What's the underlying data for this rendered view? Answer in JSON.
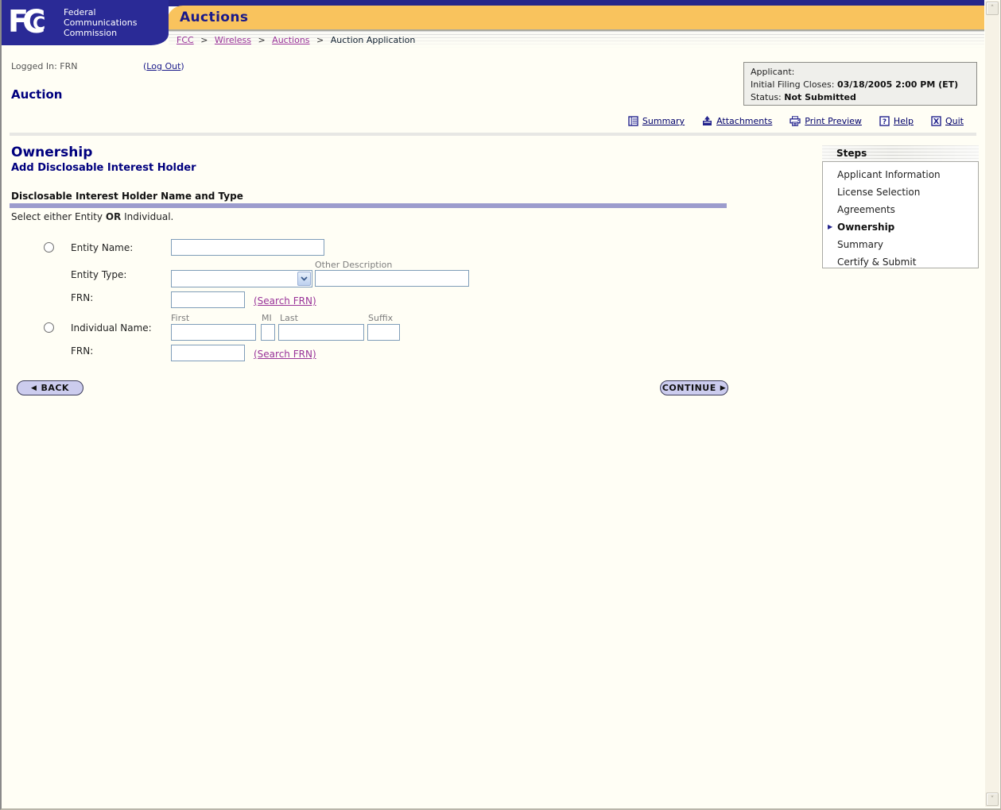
{
  "header": {
    "logo": {
      "f": "F",
      "c1": "C",
      "c2": "C",
      "org": [
        "Federal",
        "Communications",
        "Commission"
      ]
    },
    "app_title": "Auctions",
    "breadcrumb": {
      "separator": ">",
      "links": [
        "FCC",
        "Wireless",
        "Auctions"
      ],
      "current": "Auction Application"
    }
  },
  "session": {
    "logged_in": "Logged In: FRN",
    "logout_open": "(",
    "logout": "Log Out",
    "logout_close": ")"
  },
  "page": {
    "title": "Auction"
  },
  "applicant_box": {
    "applicant_label": "Applicant:",
    "filing_label": "Initial Filing Closes:",
    "filing_value": "03/18/2005 2:00 PM (ET)",
    "status_label": "Status:",
    "status_value": "Not Submitted"
  },
  "toolbar": {
    "summary": "Summary",
    "attachments": "Attachments",
    "print_preview": "Print Preview",
    "help": "Help",
    "quit": "Quit"
  },
  "icons": {
    "help_glyph": "?",
    "quit_glyph": "X",
    "up_arrow": "˄",
    "down_arrow": "˅"
  },
  "content": {
    "title": "Ownership",
    "subtitle": "Add Disclosable Interest Holder",
    "group_heading": "Disclosable Interest Holder Name and Type",
    "instruction_prefix": "Select either Entity ",
    "instruction_or": "OR",
    "instruction_suffix": " Individual."
  },
  "form": {
    "entity_name_label": "Entity Name:",
    "entity_name_value": "",
    "entity_type_label": "Entity Type:",
    "entity_type_selected": "",
    "other_description_label": "Other Description",
    "other_description_value": "",
    "entity_frn_label": "FRN:",
    "entity_frn_value": "",
    "entity_search_frn": "(Search FRN)",
    "individual_name_label": "Individual Name:",
    "first_label": "First",
    "first_value": "",
    "mi_label": "MI",
    "mi_value": "",
    "last_label": "Last",
    "last_value": "",
    "suffix_label": "Suffix",
    "suffix_value": "",
    "individual_frn_label": "FRN:",
    "individual_frn_value": "",
    "individual_search_frn": "(Search FRN)"
  },
  "buttons": {
    "back": "BACK",
    "continue": "CONTINUE",
    "back_arrow": "◀",
    "continue_arrow": "▶"
  },
  "steps": {
    "title": "Steps",
    "active_marker": "▶",
    "items": [
      {
        "label": "Applicant Information",
        "active": false
      },
      {
        "label": "License Selection",
        "active": false
      },
      {
        "label": "Agreements",
        "active": false
      },
      {
        "label": "Ownership",
        "active": true
      },
      {
        "label": "Summary",
        "active": false
      },
      {
        "label": "Certify & Submit",
        "active": false
      }
    ]
  },
  "colors": {
    "navy": "#2a2a96",
    "gold": "#f9c35d",
    "heading_navy": "#00007e",
    "link_navy": "#00006a",
    "link_purple": "#993399",
    "accent_bar": "#9c9ccd",
    "button_bg": "#ccccee",
    "input_border": "#7f9db9"
  }
}
